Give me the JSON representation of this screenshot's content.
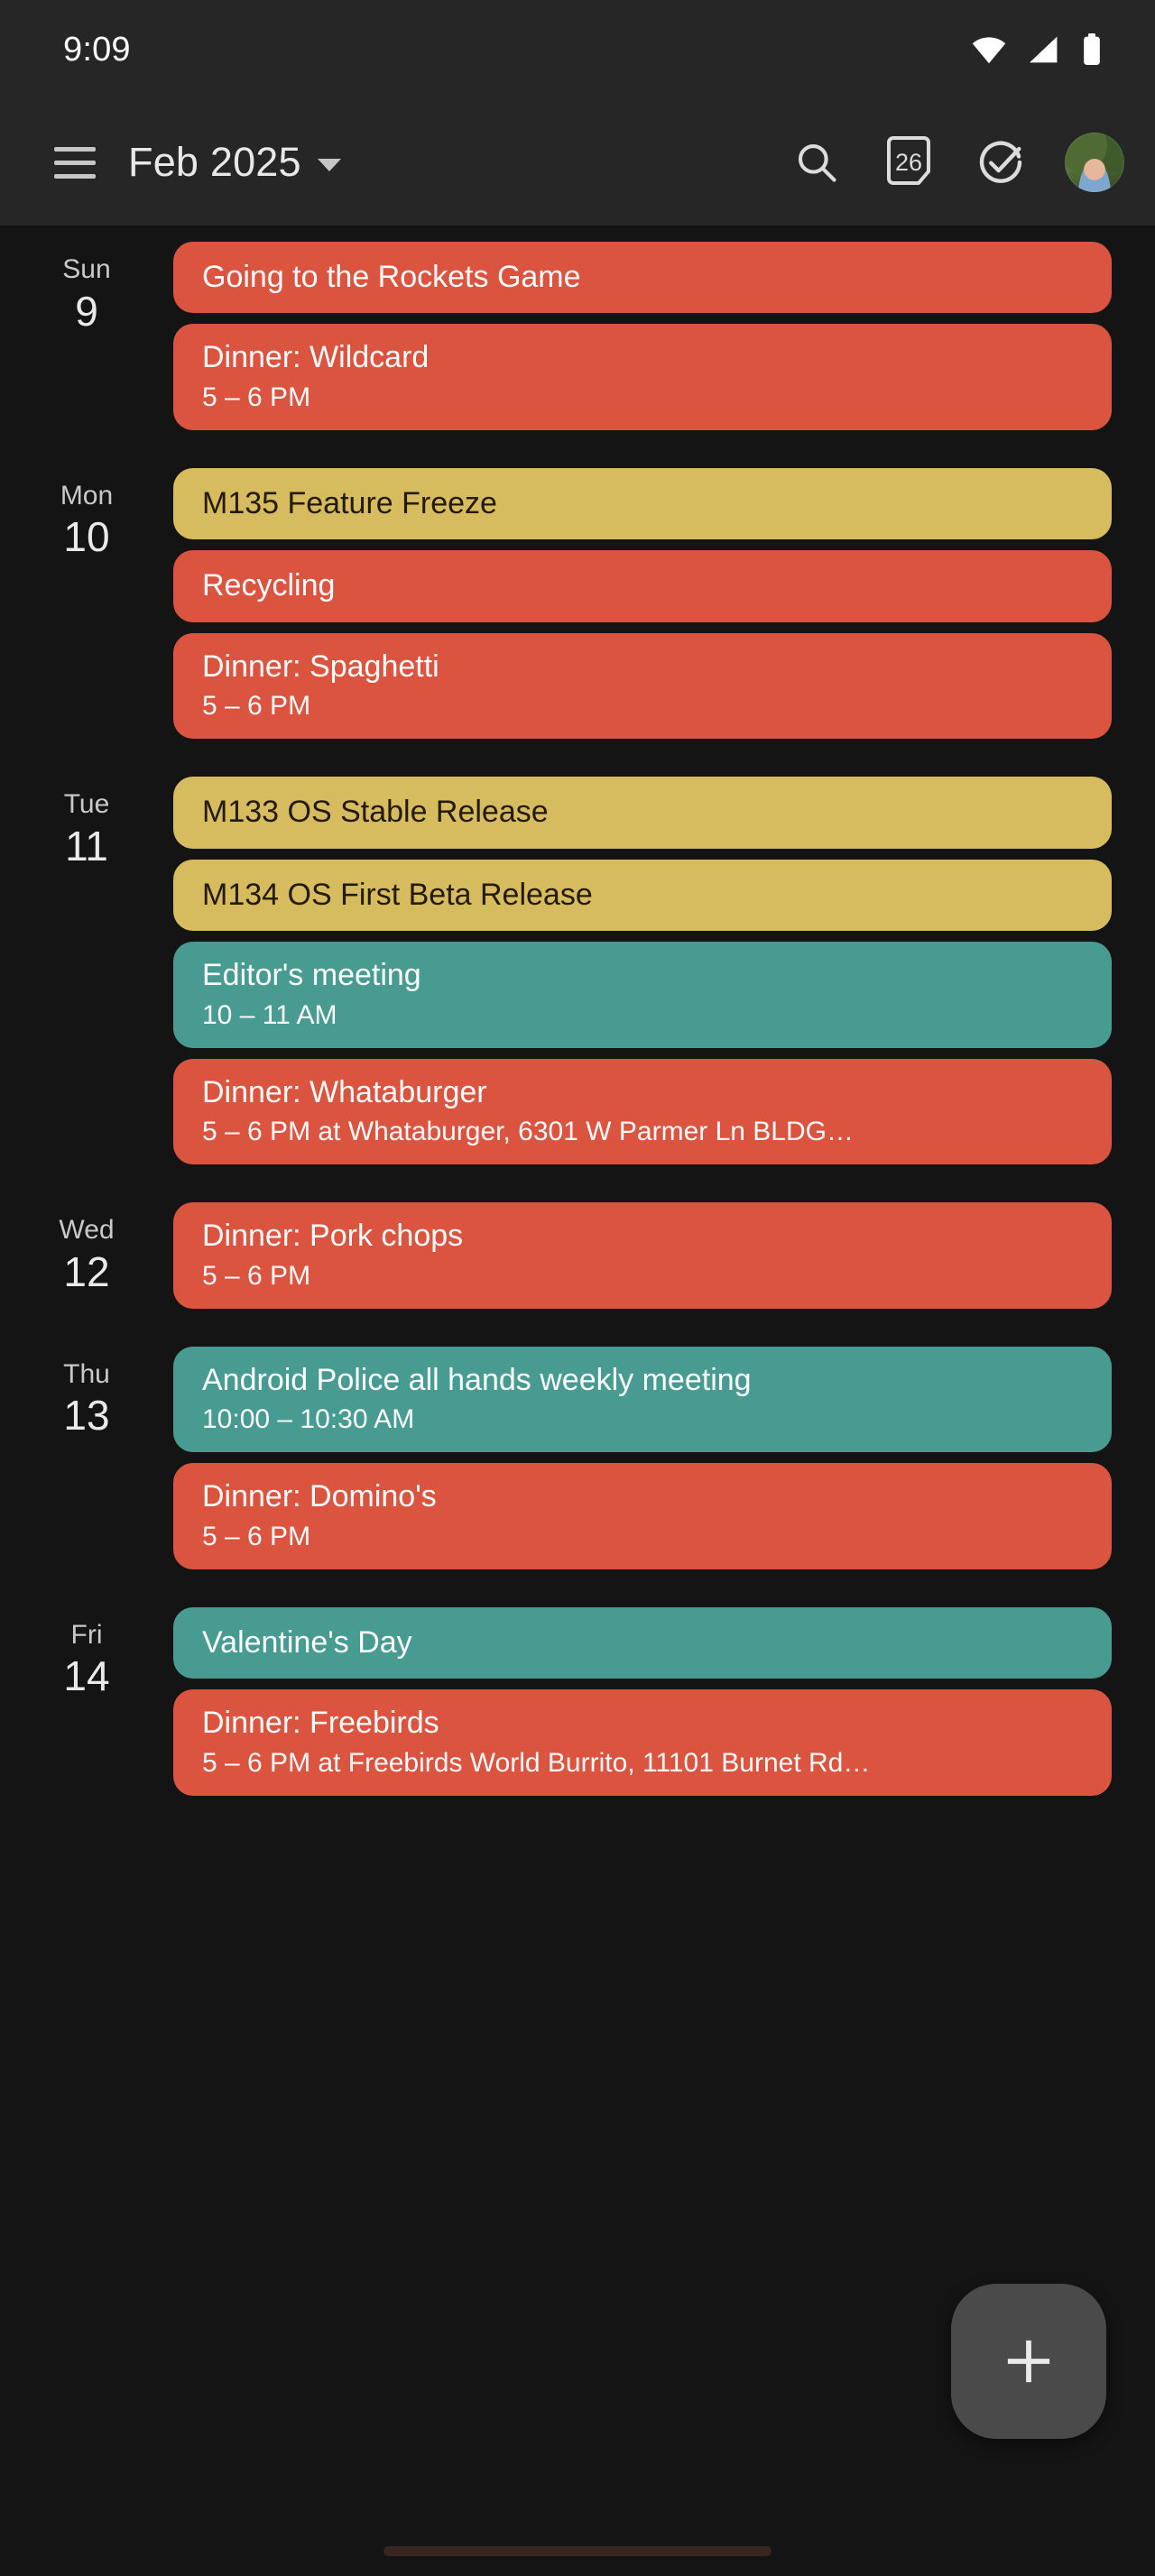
{
  "status_bar": {
    "time": "9:09",
    "icons": [
      "wifi-icon",
      "cellular-signal-icon",
      "battery-icon"
    ]
  },
  "app_bar": {
    "menu_icon": "hamburger-menu-icon",
    "title": "Feb 2025",
    "dropdown_icon": "chevron-down-icon",
    "actions": [
      {
        "name": "search-icon",
        "label": "Search"
      },
      {
        "name": "today-calendar-icon",
        "label": "26"
      },
      {
        "name": "tasks-check-circle-icon",
        "label": "Tasks"
      },
      {
        "name": "avatar",
        "label": "Account"
      }
    ]
  },
  "colors": {
    "background": "#141414",
    "app_bar": "#262626",
    "event_orange": "#DB5440",
    "event_yellow": "#D7BC5F",
    "event_teal": "#479B90",
    "fab": "#4A4A4A",
    "dark_text": "#231A08"
  },
  "fab": {
    "name": "add-event-fab",
    "icon": "plus-icon",
    "label": "+"
  },
  "agenda": {
    "days": [
      {
        "dow": "Sun",
        "day": "9",
        "events": [
          {
            "title": "Going to the Rockets Game",
            "subtitle": "",
            "color": "orange"
          },
          {
            "title": "Dinner: Wildcard",
            "subtitle": "5 – 6 PM",
            "color": "orange"
          }
        ]
      },
      {
        "dow": "Mon",
        "day": "10",
        "events": [
          {
            "title": "M135 Feature Freeze",
            "subtitle": "",
            "color": "yellow"
          },
          {
            "title": "Recycling",
            "subtitle": "",
            "color": "orange"
          },
          {
            "title": "Dinner: Spaghetti",
            "subtitle": "5 – 6 PM",
            "color": "orange"
          }
        ]
      },
      {
        "dow": "Tue",
        "day": "11",
        "events": [
          {
            "title": "M133 OS Stable Release",
            "subtitle": "",
            "color": "yellow"
          },
          {
            "title": "M134 OS First Beta Release",
            "subtitle": "",
            "color": "yellow"
          },
          {
            "title": "Editor's meeting",
            "subtitle": "10 – 11 AM",
            "color": "teal"
          },
          {
            "title": "Dinner: Whataburger",
            "subtitle": "5 – 6 PM at Whataburger, 6301 W Parmer Ln BLDG…",
            "color": "orange"
          }
        ]
      },
      {
        "dow": "Wed",
        "day": "12",
        "events": [
          {
            "title": "Dinner: Pork chops",
            "subtitle": "5 – 6 PM",
            "color": "orange"
          }
        ]
      },
      {
        "dow": "Thu",
        "day": "13",
        "events": [
          {
            "title": "Android Police all hands weekly meeting",
            "subtitle": "10:00 – 10:30 AM",
            "color": "teal"
          },
          {
            "title": "Dinner: Domino's",
            "subtitle": "5 – 6 PM",
            "color": "orange"
          }
        ]
      },
      {
        "dow": "Fri",
        "day": "14",
        "events": [
          {
            "title": "Valentine's Day",
            "subtitle": "",
            "color": "teal"
          },
          {
            "title": "Dinner: Freebirds",
            "subtitle": "5 – 6 PM at Freebirds World Burrito, 11101 Burnet Rd…",
            "color": "orange"
          }
        ]
      }
    ]
  }
}
